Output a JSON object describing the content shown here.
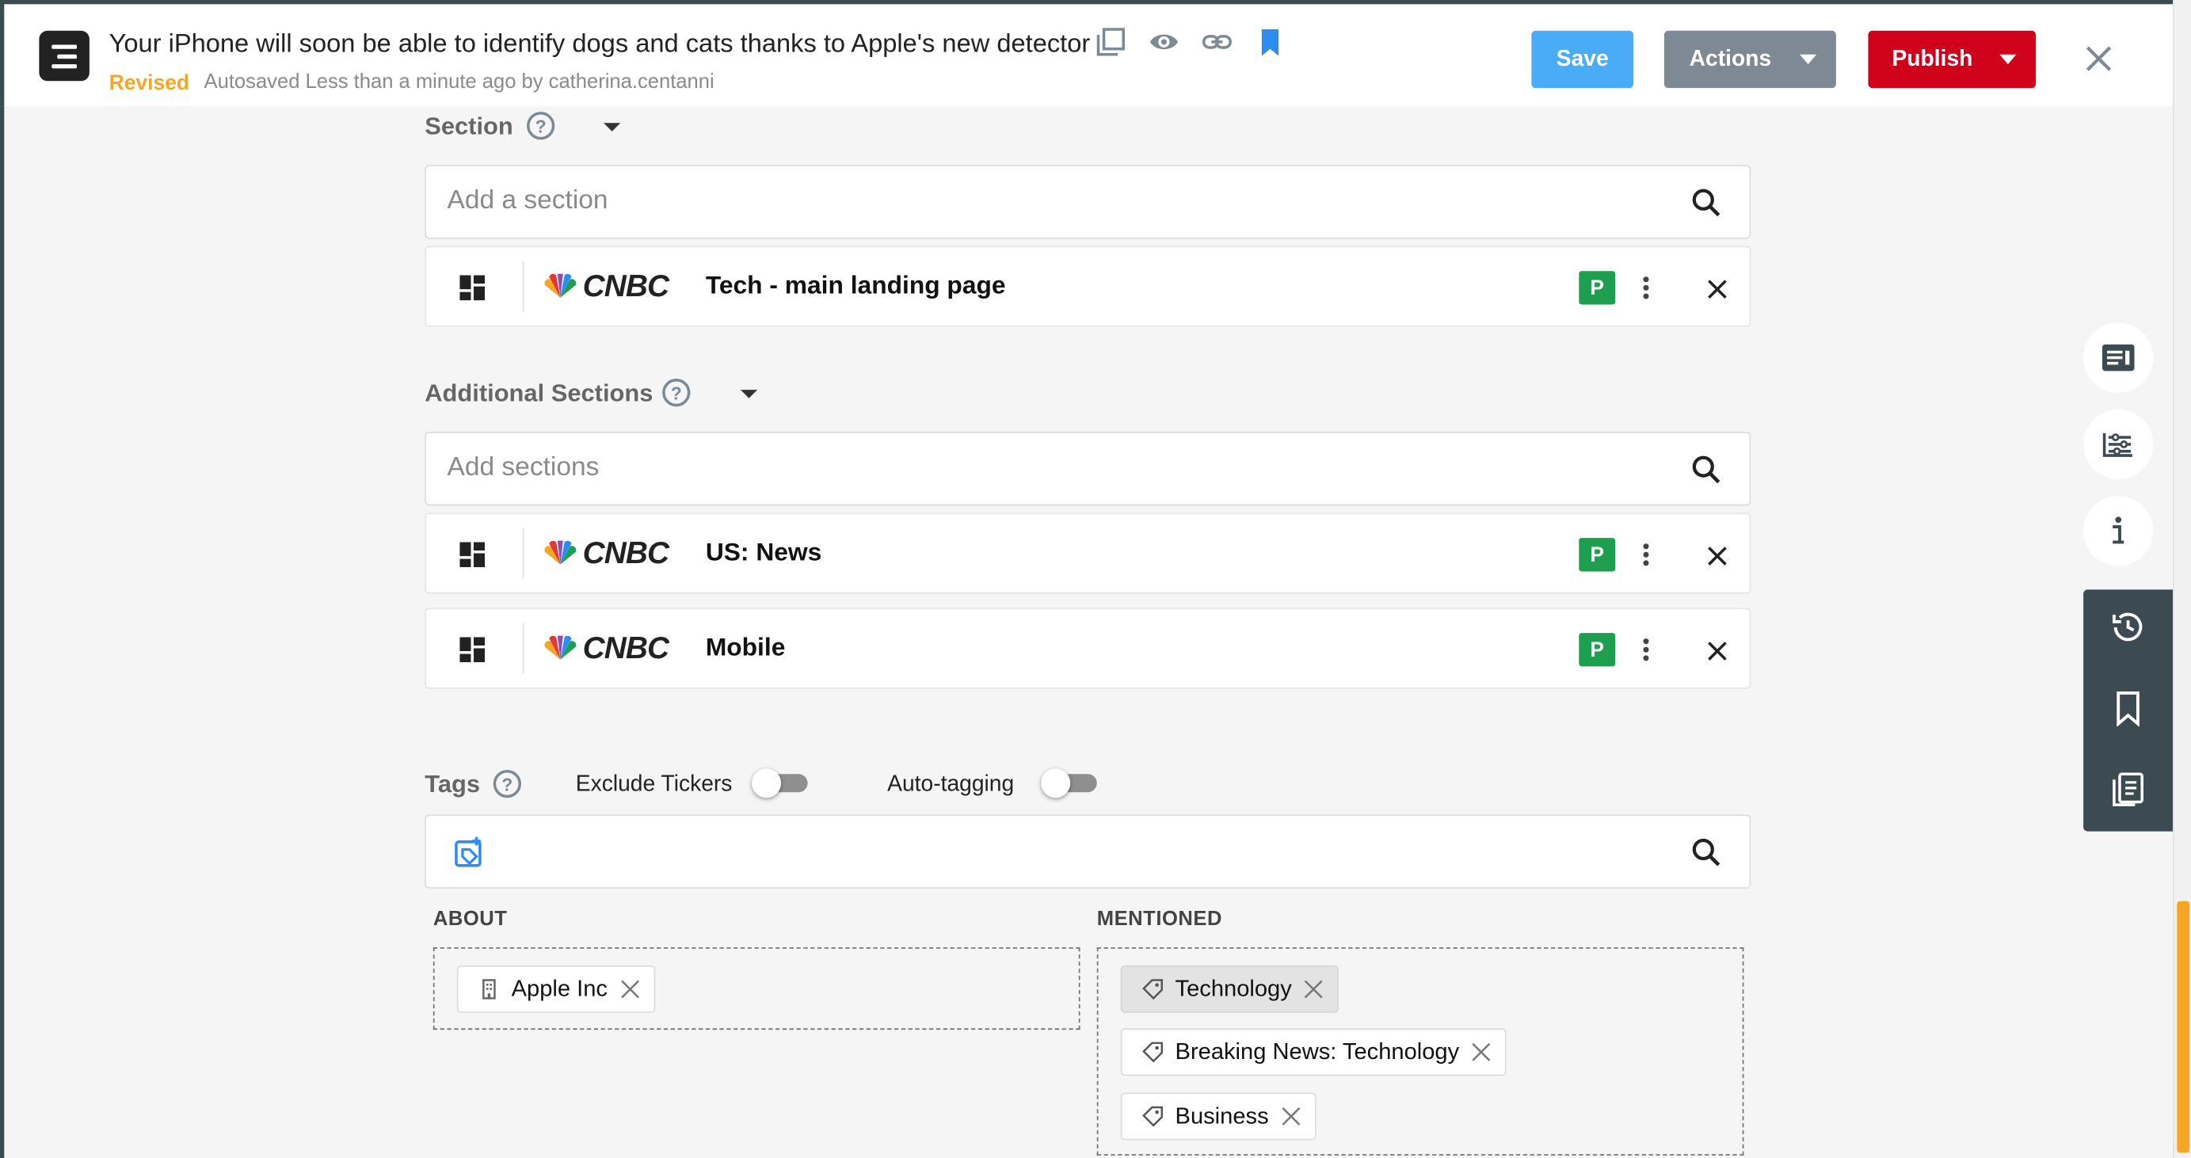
{
  "header": {
    "title": "Your iPhone will soon be able to identify dogs and cats thanks to Apple's new detector",
    "status": "Revised",
    "autosave": "Autosaved Less than a minute ago by catherina.centanni",
    "save_label": "Save",
    "actions_label": "Actions",
    "publish_label": "Publish"
  },
  "section": {
    "label": "Section",
    "help": "?",
    "placeholder": "Add a section",
    "items": [
      {
        "brand": "CNBC",
        "name": "Tech - main landing page",
        "badge": "P"
      }
    ]
  },
  "additional_sections": {
    "label": "Additional Sections",
    "help": "?",
    "placeholder": "Add sections",
    "items": [
      {
        "brand": "CNBC",
        "name": "US: News",
        "badge": "P"
      },
      {
        "brand": "CNBC",
        "name": "Mobile",
        "badge": "P"
      }
    ]
  },
  "tags": {
    "label": "Tags",
    "help": "?",
    "exclude_tickers_label": "Exclude Tickers",
    "auto_tagging_label": "Auto-tagging",
    "exclude_tickers_on": false,
    "auto_tagging_on": false,
    "about_label": "ABOUT",
    "mentioned_label": "MENTIONED",
    "about": [
      {
        "label": "Apple Inc",
        "icon": "building-icon"
      }
    ],
    "mentioned": [
      {
        "label": "Technology",
        "icon": "tag-icon"
      },
      {
        "label": "Breaking News: Technology",
        "icon": "tag-icon"
      },
      {
        "label": "Business",
        "icon": "tag-icon"
      }
    ]
  },
  "colors": {
    "save": "#4aabf7",
    "actions": "#7d8a95",
    "publish": "#d0021b",
    "revised": "#f5a623",
    "badge": "#1e9e4f",
    "sidebar": "#3c4a52"
  }
}
